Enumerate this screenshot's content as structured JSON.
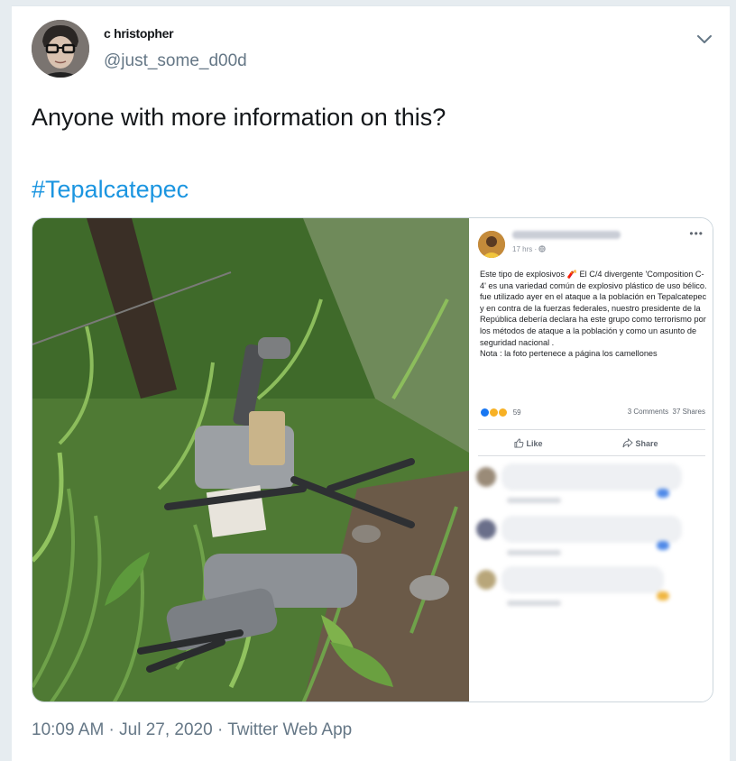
{
  "tweet": {
    "display_name": "c hristopher",
    "handle": "@just_some_d00d",
    "text": "Anyone with more information on this?",
    "hashtag": "#Tepalcatepec",
    "footer": "10:09 AM · Jul 27, 2020 · Twitter Web App"
  },
  "fb_post": {
    "time": "17 hrs · ",
    "body": "Este tipo de explosivos 🧨 El C/4 divergente 'Composition C-4' es una variedad común de explosivo plástico de uso bélico. fue utilizado ayer en el ataque a la población en Tepalcatepec y en contra de la fuerzas federales, nuestro presidente de la República debería declara ha este grupo como terrorismo por los métodos de ataque a la población y como un asunto de seguridad nacional .\nNota : la foto pertenece a página los camellones",
    "reaction_count": "59",
    "counts": "3 Comments  37 Shares",
    "like_label": "Like",
    "share_label": "Share",
    "dots": "•••"
  },
  "colors": {
    "link": "#1b95e0",
    "secondary": "#657786",
    "text": "#14171a"
  },
  "icons": [
    "chevron-down-icon",
    "globe-icon",
    "thumbs-up-icon",
    "share-icon",
    "like-reaction-icon",
    "wow-reaction-icon",
    "sad-reaction-icon"
  ]
}
